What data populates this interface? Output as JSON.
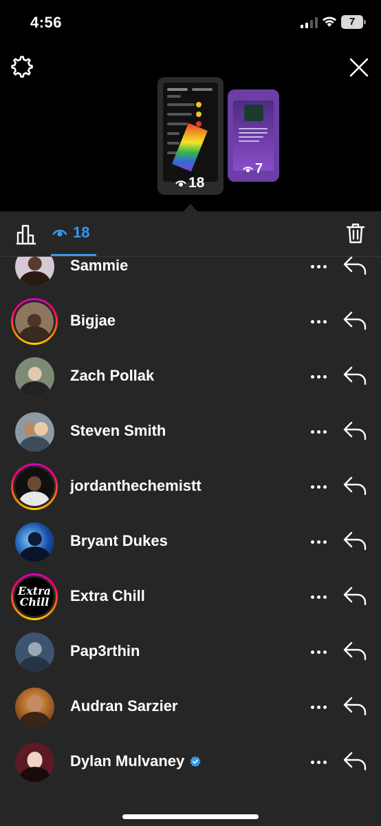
{
  "status_bar": {
    "time": "4:56",
    "battery_level": "7"
  },
  "stories": [
    {
      "views": "18",
      "selected": true
    },
    {
      "views": "7",
      "selected": false
    }
  ],
  "sheet": {
    "views_count": "18",
    "accent_color": "#3797f0"
  },
  "viewers": [
    {
      "name": "Sammie",
      "verified": false,
      "story_ring": false
    },
    {
      "name": "Bigjae",
      "verified": false,
      "story_ring": true
    },
    {
      "name": "Zach Pollak",
      "verified": false,
      "story_ring": false
    },
    {
      "name": "Steven Smith",
      "verified": false,
      "story_ring": false
    },
    {
      "name": "jordanthechemistt",
      "verified": false,
      "story_ring": true
    },
    {
      "name": "Bryant Dukes",
      "verified": false,
      "story_ring": false
    },
    {
      "name": "Extra Chill",
      "verified": false,
      "story_ring": true,
      "avatar_logo": [
        "Extra",
        "Chill"
      ]
    },
    {
      "name": "Pap3rthin",
      "verified": false,
      "story_ring": false
    },
    {
      "name": "Audran Sarzier",
      "verified": false,
      "story_ring": false
    },
    {
      "name": "Dylan Mulvaney",
      "verified": true,
      "story_ring": false
    }
  ],
  "icons": {
    "settings": "gear-icon",
    "close": "close-icon",
    "insights": "bar-chart-icon",
    "views": "eye-icon",
    "delete": "trash-icon",
    "more": "more-icon",
    "reply": "reply-icon",
    "verified": "verified-badge-icon"
  }
}
